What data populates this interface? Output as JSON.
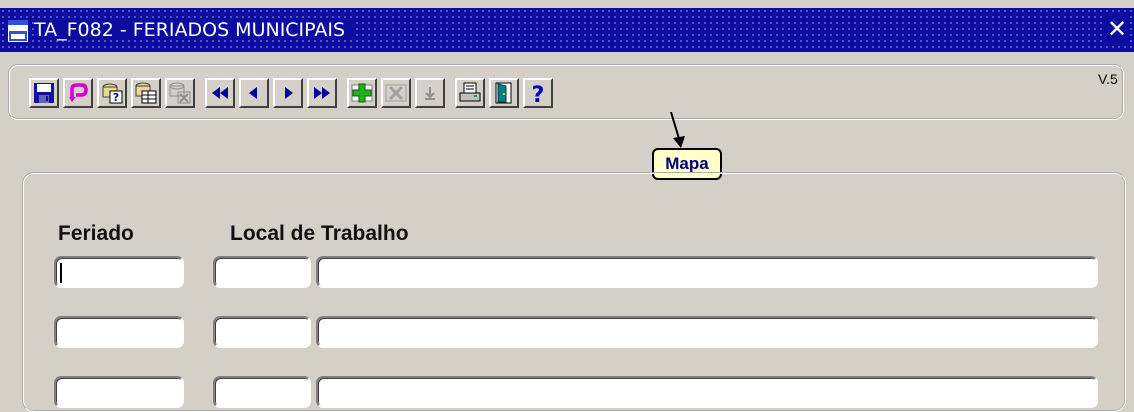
{
  "window": {
    "title": "TA_F082 - FERIADOS MUNICIPAIS",
    "app_icon": "form-window-icon",
    "close_icon": "close-icon",
    "close_glyph": "✕"
  },
  "toolbar": {
    "version": "V.5",
    "buttons": [
      {
        "name": "save-button",
        "icon": "floppy-disk-icon"
      },
      {
        "name": "undo-button",
        "icon": "undo-arrow-icon"
      },
      {
        "name": "enter-query-button",
        "icon": "query-help-icon"
      },
      {
        "name": "execute-query-button",
        "icon": "execute-query-icon"
      },
      {
        "name": "cancel-query-button",
        "icon": "cancel-query-icon"
      },
      {
        "name": "first-record-button",
        "icon": "double-left-arrow-icon"
      },
      {
        "name": "previous-record-button",
        "icon": "left-arrow-icon"
      },
      {
        "name": "next-record-button",
        "icon": "right-arrow-icon"
      },
      {
        "name": "last-record-button",
        "icon": "double-right-arrow-icon"
      },
      {
        "name": "insert-record-button",
        "icon": "plus-icon"
      },
      {
        "name": "delete-record-button",
        "icon": "delete-x-icon"
      },
      {
        "name": "duplicate-record-button",
        "icon": "down-arrow-icon"
      },
      {
        "name": "print-button",
        "icon": "printer-icon"
      },
      {
        "name": "exit-button",
        "icon": "exit-door-icon"
      },
      {
        "name": "help-button",
        "icon": "question-mark-icon"
      }
    ]
  },
  "tooltip": {
    "text": "Mapa"
  },
  "form": {
    "columns": {
      "feriado": "Feriado",
      "local_trabalho": "Local de Trabalho"
    },
    "rows": [
      {
        "feriado": "",
        "local_code": "",
        "local_desc": "",
        "focused": true
      },
      {
        "feriado": "",
        "local_code": "",
        "local_desc": "",
        "focused": false
      },
      {
        "feriado": "",
        "local_code": "",
        "local_desc": "",
        "focused": false
      }
    ]
  },
  "colors": {
    "titlebar": "#0c0ca0",
    "window_bg": "#d4d0c8",
    "tooltip_bg": "#ffffc8",
    "tooltip_text": "#000080"
  }
}
